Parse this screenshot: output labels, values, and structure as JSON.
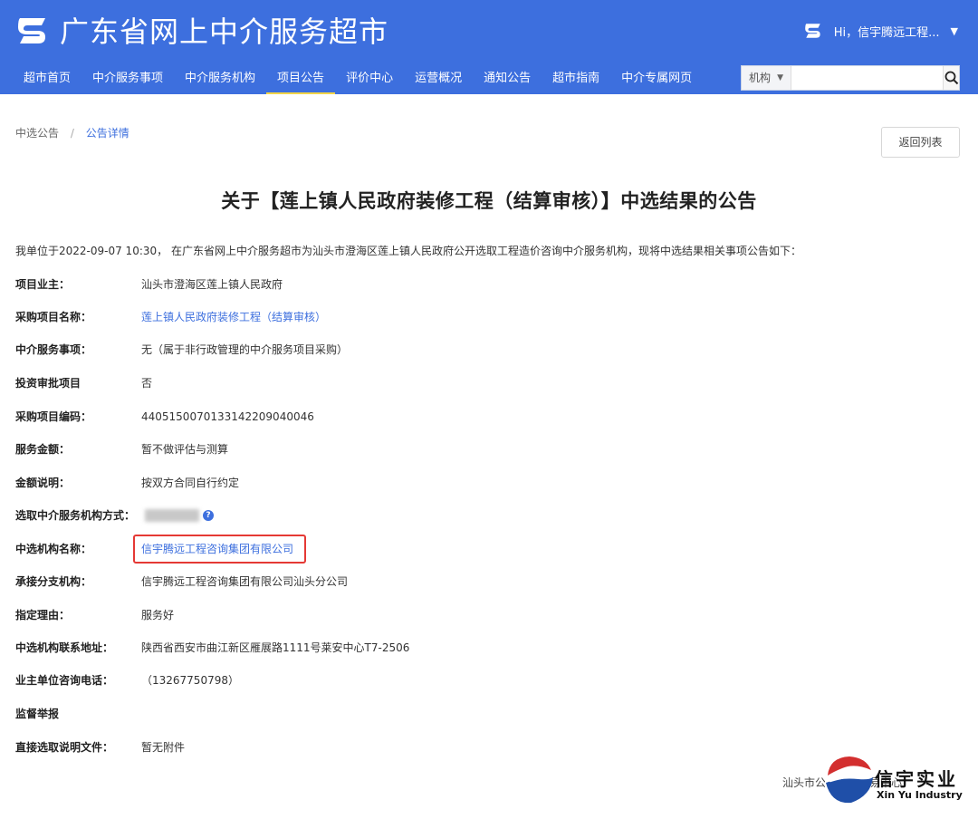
{
  "header": {
    "site_title": "广东省网上中介服务超市",
    "user_greeting": "Hi，信宇腾远工程...",
    "brand_color": "#3d6fde"
  },
  "nav": {
    "items": [
      {
        "label": "超市首页",
        "active": false
      },
      {
        "label": "中介服务事项",
        "active": false
      },
      {
        "label": "中介服务机构",
        "active": false
      },
      {
        "label": "项目公告",
        "active": true
      },
      {
        "label": "评价中心",
        "active": false
      },
      {
        "label": "运营概况",
        "active": false
      },
      {
        "label": "通知公告",
        "active": false
      },
      {
        "label": "超市指南",
        "active": false
      },
      {
        "label": "中介专属网页",
        "active": false
      }
    ],
    "active_indicator_color": "#f2d447"
  },
  "search": {
    "category_selected": "机构",
    "placeholder": "",
    "icon": "search-icon"
  },
  "breadcrumb": {
    "parent": "中选公告",
    "separator": "/",
    "current": "公告详情"
  },
  "back_button_label": "返回列表",
  "notice": {
    "title": "关于【莲上镇人民政府装修工程（结算审核）】中选结果的公告",
    "intro": "我单位于2022-09-07 10:30， 在广东省网上中介服务超市为汕头市澄海区莲上镇人民政府公开选取工程造价咨询中介服务机构，现将中选结果相关事项公告如下：",
    "fields": [
      {
        "label": "项目业主：",
        "value": "汕头市澄海区莲上镇人民政府",
        "link": false
      },
      {
        "label": "采购项目名称：",
        "value": "莲上镇人民政府装修工程（结算审核）",
        "link": true
      },
      {
        "label": "中介服务事项：",
        "value": "无（属于非行政管理的中介服务项目采购）",
        "link": false
      },
      {
        "label": "投资审批项目",
        "value": "否",
        "link": false
      },
      {
        "label": "采购项目编码：",
        "value": "440515007013314220904004​6",
        "link": false
      },
      {
        "label": "服务金额：",
        "value": "暂不做评估与测算",
        "link": false
      },
      {
        "label": "金额说明：",
        "value": "按双方合同自行约定",
        "link": false
      },
      {
        "label": "选取中介服务机构方式：",
        "value": "",
        "link": false
      },
      {
        "label": "中选机构名称：",
        "value": "信宇腾远工程咨询集团有限公司",
        "link": true
      },
      {
        "label": "承接分支机构：",
        "value": "信宇腾远工程咨询集团有限公司汕头分公司",
        "link": false
      },
      {
        "label": "指定理由：",
        "value": "服务好",
        "link": false
      },
      {
        "label": "中选机构联系地址：",
        "value": "陕西省西安市曲江新区雁展路1111号莱安中心T7-2506",
        "link": false
      },
      {
        "label": "业主单位咨询电话：",
        "value": "（13267750798）",
        "link": false
      },
      {
        "label": "监督举报",
        "value": "",
        "link": false
      },
      {
        "label": "直接选取说明文件：",
        "value": "暂无附件",
        "link": false
      }
    ],
    "highlight_color": "#e53935"
  },
  "footer": {
    "org_partial": "汕头市公共资源交易中心"
  },
  "watermark": {
    "cn": "信宇实业",
    "en": "Xin Yu Industry"
  }
}
